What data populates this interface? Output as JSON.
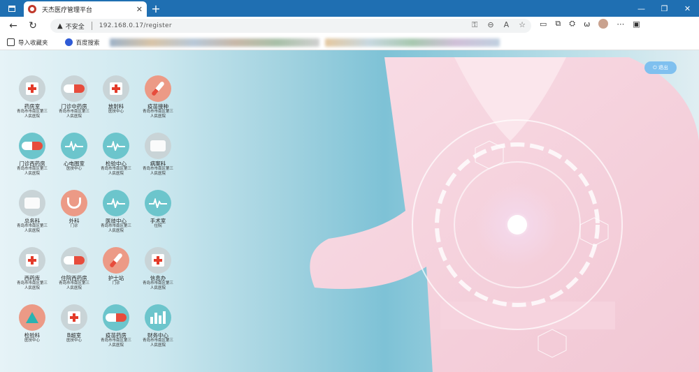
{
  "browser": {
    "tab_title": "天杰医疗管理平台",
    "new_tab": "+",
    "insecure_label": "不安全",
    "url": "192.168.0.17/register",
    "bookmarks": [
      {
        "label": "导入收藏夹"
      },
      {
        "label": "百度搜索"
      }
    ]
  },
  "page": {
    "logout_label": "退出",
    "tiles": [
      {
        "name": "药房室",
        "sub": [
          "青岛市市南区第三",
          "人民医院"
        ],
        "icon": "cross-icon",
        "color": "gray"
      },
      {
        "name": "门诊中药房",
        "sub": [
          "青岛市市南区第三",
          "人民医院"
        ],
        "icon": "pill-icon",
        "color": "gray"
      },
      {
        "name": "放射科",
        "sub": [
          "医技中心"
        ],
        "icon": "cross-icon",
        "color": "gray"
      },
      {
        "name": "疫苗接种",
        "sub": [
          "青岛市市南区第三",
          "人民医院"
        ],
        "icon": "syringe-icon",
        "color": "salmon"
      },
      {
        "name": "门诊西药房",
        "sub": [
          "青岛市市南区第三",
          "人民医院"
        ],
        "icon": "pill-icon",
        "color": "teal"
      },
      {
        "name": "心电图室",
        "sub": [
          "医技中心"
        ],
        "icon": "pulse-icon",
        "color": "teal"
      },
      {
        "name": "检验中心",
        "sub": [
          "青岛市市南区第三",
          "人民医院"
        ],
        "icon": "pulse-icon",
        "color": "teal"
      },
      {
        "name": "病案科",
        "sub": [
          "青岛市市南区第三",
          "人民医院"
        ],
        "icon": "chat-icon",
        "color": "gray"
      },
      {
        "name": "总务科",
        "sub": [
          "青岛市市南区第三",
          "人民医院"
        ],
        "icon": "chat-icon",
        "color": "gray"
      },
      {
        "name": "外科",
        "sub": [
          "门诊"
        ],
        "icon": "stethoscope-icon",
        "color": "salmon"
      },
      {
        "name": "医技中心",
        "sub": [
          "青岛市市南区第三",
          "人民医院"
        ],
        "icon": "pulse-icon",
        "color": "teal"
      },
      {
        "name": "手术室",
        "sub": [
          "住院"
        ],
        "icon": "pulse-icon",
        "color": "teal"
      },
      {
        "name": "西药库",
        "sub": [
          "青岛市市南区第三",
          "人民医院"
        ],
        "icon": "cross-icon",
        "color": "gray"
      },
      {
        "name": "住院西药房",
        "sub": [
          "青岛市市南区第三",
          "人民医院"
        ],
        "icon": "pill-icon",
        "color": "gray"
      },
      {
        "name": "护士站",
        "sub": [
          "门诊"
        ],
        "icon": "syringe-icon",
        "color": "salmon"
      },
      {
        "name": "信息办",
        "sub": [
          "青岛市市南区第三",
          "人民医院"
        ],
        "icon": "cross-icon",
        "color": "gray"
      },
      {
        "name": "检验科",
        "sub": [
          "医技中心"
        ],
        "icon": "flask-icon",
        "color": "salmon"
      },
      {
        "name": "B超室",
        "sub": [
          "医技中心"
        ],
        "icon": "cross-icon",
        "color": "gray"
      },
      {
        "name": "疫苗药房",
        "sub": [
          "青岛市市南区第三",
          "人民医院"
        ],
        "icon": "pill-icon",
        "color": "teal"
      },
      {
        "name": "财务中心",
        "sub": [
          "青岛市市南区第三",
          "人民医院"
        ],
        "icon": "bars-icon",
        "color": "teal"
      }
    ]
  }
}
